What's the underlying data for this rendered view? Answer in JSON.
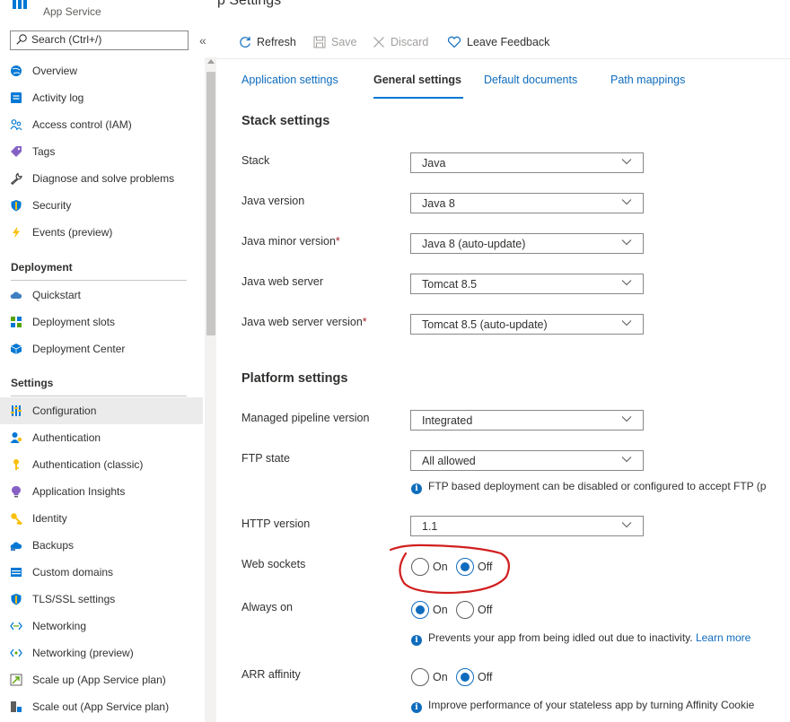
{
  "header": {
    "subtitle": "App Service",
    "title_fragment": "p Settings"
  },
  "sidebar": {
    "search_placeholder": "Search (Ctrl+/)",
    "collapse_glyph": "«",
    "items": [
      {
        "label": "Overview",
        "icon": "globe-icon",
        "color": "#0078d4"
      },
      {
        "label": "Activity log",
        "icon": "log-icon",
        "color": "#0078d4"
      },
      {
        "label": "Access control (IAM)",
        "icon": "people-icon",
        "color": "#0078d4"
      },
      {
        "label": "Tags",
        "icon": "tag-icon",
        "color": "#8661c5"
      },
      {
        "label": "Diagnose and solve problems",
        "icon": "wrench-icon",
        "color": "#605e5c"
      },
      {
        "label": "Security",
        "icon": "shield-icon",
        "color": "#0078d4"
      },
      {
        "label": "Events (preview)",
        "icon": "lightning-icon",
        "color": "#f8c00c"
      }
    ],
    "sections": [
      {
        "title": "Deployment",
        "items": [
          {
            "label": "Quickstart",
            "icon": "cloud-icon",
            "color": "#3f7fbf"
          },
          {
            "label": "Deployment slots",
            "icon": "slots-icon",
            "color": "#57a300"
          },
          {
            "label": "Deployment Center",
            "icon": "cube-icon",
            "color": "#0078d4"
          }
        ]
      },
      {
        "title": "Settings",
        "items": [
          {
            "label": "Configuration",
            "icon": "sliders-icon",
            "color": "#0078d4",
            "active": true
          },
          {
            "label": "Authentication",
            "icon": "person-icon",
            "color": "#0078d4"
          },
          {
            "label": "Authentication (classic)",
            "icon": "key-icon",
            "color": "#f8c00c"
          },
          {
            "label": "Application Insights",
            "icon": "lightbulb-icon",
            "color": "#8661c5"
          },
          {
            "label": "Identity",
            "icon": "identity-key-icon",
            "color": "#f8c00c"
          },
          {
            "label": "Backups",
            "icon": "cloud-backup-icon",
            "color": "#0078d4"
          },
          {
            "label": "Custom domains",
            "icon": "domains-icon",
            "color": "#0078d4"
          },
          {
            "label": "TLS/SSL settings",
            "icon": "shield-icon",
            "color": "#0078d4"
          },
          {
            "label": "Networking",
            "icon": "network-icon",
            "color": "#0078d4"
          },
          {
            "label": "Networking (preview)",
            "icon": "network-preview-icon",
            "color": "#0078d4"
          },
          {
            "label": "Scale up (App Service plan)",
            "icon": "scale-up-icon",
            "color": "#0078d4"
          },
          {
            "label": "Scale out (App Service plan)",
            "icon": "scale-out-icon",
            "color": "#605e5c"
          }
        ]
      }
    ]
  },
  "toolbar": {
    "refresh": "Refresh",
    "save": "Save",
    "discard": "Discard",
    "feedback": "Leave Feedback"
  },
  "tabs": [
    "Application settings",
    "General settings",
    "Default documents",
    "Path mappings"
  ],
  "stack": {
    "heading": "Stack settings",
    "rows": [
      {
        "label": "Stack",
        "value": "Java",
        "required": false
      },
      {
        "label": "Java version",
        "value": "Java 8",
        "required": false
      },
      {
        "label": "Java minor version",
        "value": "Java 8 (auto-update)",
        "required": true
      },
      {
        "label": "Java web server",
        "value": "Tomcat 8.5",
        "required": false
      },
      {
        "label": "Java web server version",
        "value": "Tomcat 8.5 (auto-update)",
        "required": true
      }
    ]
  },
  "platform": {
    "heading": "Platform settings",
    "pipeline": {
      "label": "Managed pipeline version",
      "value": "Integrated"
    },
    "ftp": {
      "label": "FTP state",
      "value": "All allowed",
      "info": "FTP based deployment can be disabled or configured to accept FTP (p"
    },
    "http": {
      "label": "HTTP version",
      "value": "1.1"
    },
    "websockets": {
      "label": "Web sockets",
      "on": "On",
      "off": "Off",
      "selected": "Off"
    },
    "alwayson": {
      "label": "Always on",
      "on": "On",
      "off": "Off",
      "selected": "On",
      "info": "Prevents your app from being idled out due to inactivity.",
      "link": "Learn more"
    },
    "arr": {
      "label": "ARR affinity",
      "on": "On",
      "off": "Off",
      "selected": "Off",
      "info": "Improve performance of your stateless app by turning Affinity Cookie"
    }
  },
  "colors": {
    "accent": "#0078d4",
    "link": "#0f6cbd",
    "annotation": "#d11f1f",
    "required": "#a4262c"
  }
}
